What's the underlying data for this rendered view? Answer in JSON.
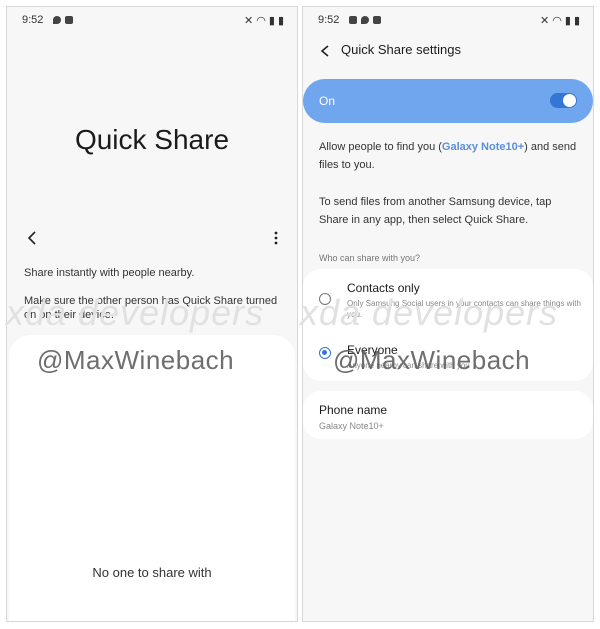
{
  "left_phone": {
    "status_time": "9:52",
    "title": "Quick Share",
    "share_instant_text": "Share instantly with people nearby.",
    "make_sure_text": "Make sure the other person has Quick Share turned on on their device.",
    "empty_state_text": "No one to share with"
  },
  "right_phone": {
    "status_time": "9:52",
    "header_title": "Quick Share settings",
    "on_label": "On",
    "toggle_on": true,
    "allow_prefix": "Allow people to find you (",
    "device_name_highlight": "Galaxy Note10+",
    "allow_suffix": ") and send files to you.",
    "send_files_text": "To send files from another Samsung device, tap Share in any app, then select Quick Share.",
    "who_heading": "Who can share with you?",
    "options": [
      {
        "title": "Contacts only",
        "subtitle": "Only Samsung Social users in your contacts can share things with you.",
        "selected": false
      },
      {
        "title": "Everyone",
        "subtitle": "Anyone nearby can share with you",
        "selected": true
      }
    ],
    "phone_name_title": "Phone name",
    "phone_name_value": "Galaxy Note10+"
  },
  "watermarks": {
    "handle": "@MaxWinebach",
    "xda": "xda developers"
  },
  "colors": {
    "accent": "#3476d6",
    "on_bar": "#6fa6ee",
    "highlight": "#5b8fd8"
  }
}
